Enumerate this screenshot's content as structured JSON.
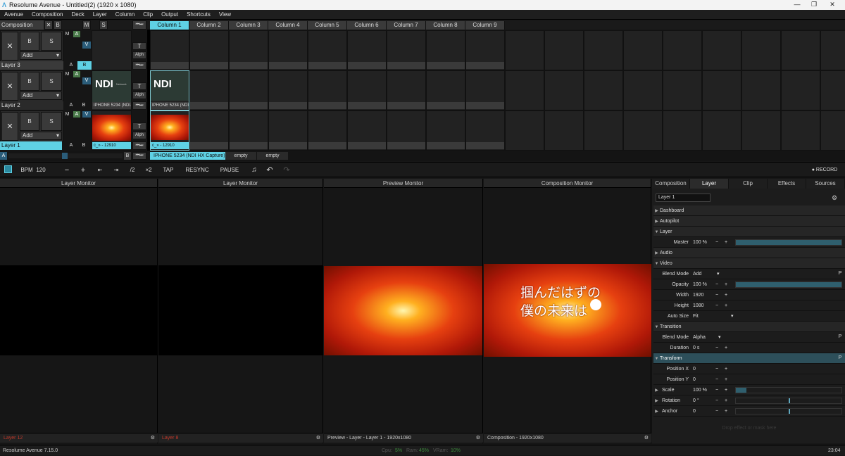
{
  "window": {
    "title": "Resolume Avenue - Untitled(2) (1920 x 1080)",
    "minimize": "—",
    "maximize": "❐",
    "close": "✕"
  },
  "menu": [
    "Avenue",
    "Composition",
    "Deck",
    "Layer",
    "Column",
    "Clip",
    "Output",
    "Shortcuts",
    "View"
  ],
  "composition": {
    "label": "Composition",
    "x": "✕",
    "b": "B",
    "m": "M",
    "s": "S"
  },
  "columns": [
    "Column 1",
    "Column 2",
    "Column 3",
    "Column 4",
    "Column 5",
    "Column 6",
    "Column 7",
    "Column 8",
    "Column 9"
  ],
  "layer_controls": {
    "x": "✕",
    "b": "B",
    "s": "S",
    "add": "Add",
    "m": "M",
    "a": "A",
    "v": "V",
    "t": "T",
    "alph": "Alph",
    "play": "⏮⏭"
  },
  "layers": [
    {
      "name": "Layer 3",
      "clip_label": "",
      "col1_label": ""
    },
    {
      "name": "Layer 2",
      "clip_label": "IPHONE 5234 (NDI...",
      "col1_label": "IPHONE 5234 (NDI...",
      "ndi_sub": "Network Device Interface"
    },
    {
      "name": "Layer 1",
      "clip_label": "c_» - 12910",
      "col1_label": "c_» - 12910"
    }
  ],
  "decks": {
    "a": "A",
    "b": "B",
    "items": [
      "IPHONE 5234 (NDI HX Capture)",
      "empty",
      "empty"
    ]
  },
  "ndi_text": "NDI",
  "transport": {
    "bpm_label": "BPM",
    "bpm": "120",
    "minus": "−",
    "plus": "+",
    "nudge_l": "⇤",
    "nudge_r": "⇥",
    "half": "/2",
    "double": "×2",
    "tap": "TAP",
    "resync": "RESYNC",
    "pause": "PAUSE",
    "record": "● RECORD"
  },
  "monitors": [
    {
      "title": "Layer Monitor",
      "footer": "Layer 12"
    },
    {
      "title": "Layer Monitor",
      "footer": "Layer 8"
    },
    {
      "title": "Preview Monitor",
      "footer": "Preview - Layer - Layer 1 - 1920x1080"
    },
    {
      "title": "Composition Monitor",
      "footer": "Composition - 1920x1080"
    }
  ],
  "overlay_text": [
    "掴んだはずの",
    "僕の未来は"
  ],
  "panel": {
    "tabs": [
      "Composition",
      "Layer",
      "Clip",
      "Effects",
      "Sources"
    ],
    "selected_tab": "Layer",
    "layer_name": "Layer 1",
    "sections": {
      "dashboard": "Dashboard",
      "autopilot": "Autopilot",
      "layer": "Layer",
      "audio": "Audio",
      "video": "Video",
      "transition": "Transition",
      "transform": "Transform"
    },
    "params": {
      "master": {
        "label": "Master",
        "value": "100 %",
        "level": 1.0
      },
      "blend_mode": {
        "label": "Blend Mode",
        "value": "Add"
      },
      "opacity": {
        "label": "Opacity",
        "value": "100 %",
        "level": 1.0
      },
      "width": {
        "label": "Width",
        "value": "1920"
      },
      "height": {
        "label": "Height",
        "value": "1080"
      },
      "auto_size": {
        "label": "Auto Size",
        "value": "Fit"
      },
      "trans_blend": {
        "label": "Blend Mode",
        "value": "Alpha"
      },
      "duration": {
        "label": "Duration",
        "value": "0 s"
      },
      "pos_x": {
        "label": "Position X",
        "value": "0"
      },
      "pos_y": {
        "label": "Position Y",
        "value": "0"
      },
      "scale": {
        "label": "Scale",
        "value": "100 %",
        "level": 0.1
      },
      "rotation": {
        "label": "Rotation",
        "value": "0 °",
        "level": 0.5
      },
      "anchor": {
        "label": "Anchor",
        "value": "0",
        "level": 0.5
      }
    },
    "drop_hint": "Drop effect or mask here",
    "p_btn": "P"
  },
  "status": {
    "version": "Resolume Avenue 7.15.0",
    "cpu_label": "Cpu:",
    "cpu": "5%",
    "ram_label": "Ram:",
    "ram": "45%",
    "vram_label": "VRam:",
    "vram": "10%",
    "time": "23:04"
  },
  "colors": {
    "accent": "#5fd1e4",
    "green": "#4a7a4a",
    "blue": "#2b5d7a",
    "footer_red": "#c0392b",
    "status_green": "#3c8a3c"
  }
}
